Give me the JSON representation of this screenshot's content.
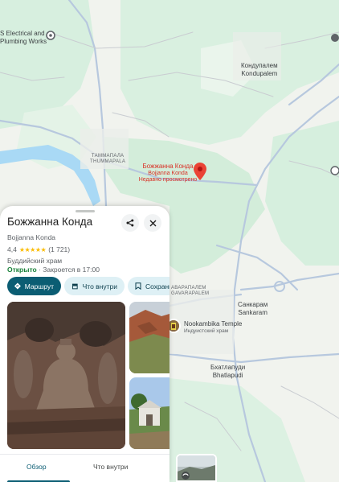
{
  "map": {
    "labels": {
      "electrical_line1": "S Electrical and",
      "electrical_line2": "Plumbing Works",
      "kondupalem_ru": "Кондупалем",
      "kondupalem_en": "Kondupalem",
      "tammapala_ru": "ТАММАПАЛА",
      "tammapala_en": "THUMMAPALA",
      "gavarapalem_ru": "АВАРАПАЛЕМ",
      "gavarapalem_en": "GAVARAPALEM",
      "sankaram_ru": "Санкарам",
      "sankaram_en": "Sankaram",
      "bhatlapudi_ru": "Бхатлапуди",
      "bhatlapudi_en": "Bhatlapudi"
    },
    "selected_place": {
      "name_ru": "Божжанна Конда",
      "name_en": "Bojjanna Konda",
      "note": "Недавно просмотрено"
    },
    "poi_temple": {
      "name": "Nookambika Temple",
      "category": "Индуистский храм"
    },
    "colors": {
      "park": "#d6efdc",
      "water": "#a9d9f5",
      "road": "#a8c0dc",
      "pin": "#ea4335"
    }
  },
  "panel": {
    "title": "Божжанна Конда",
    "subtitle": "Bojjanna Konda",
    "rating": "4,4",
    "stars": "★★★★★",
    "review_count": "(1 721)",
    "category": "Буддийский храм",
    "status_open": "Открыто",
    "status_sep": " · ",
    "status_close": "Закроется в 17:00",
    "buttons": {
      "directions": "Маршрут",
      "inside": "Что внутри",
      "save": "Сохранить"
    },
    "tabs": {
      "overview": "Обзор",
      "inside": "Что внутри"
    }
  }
}
